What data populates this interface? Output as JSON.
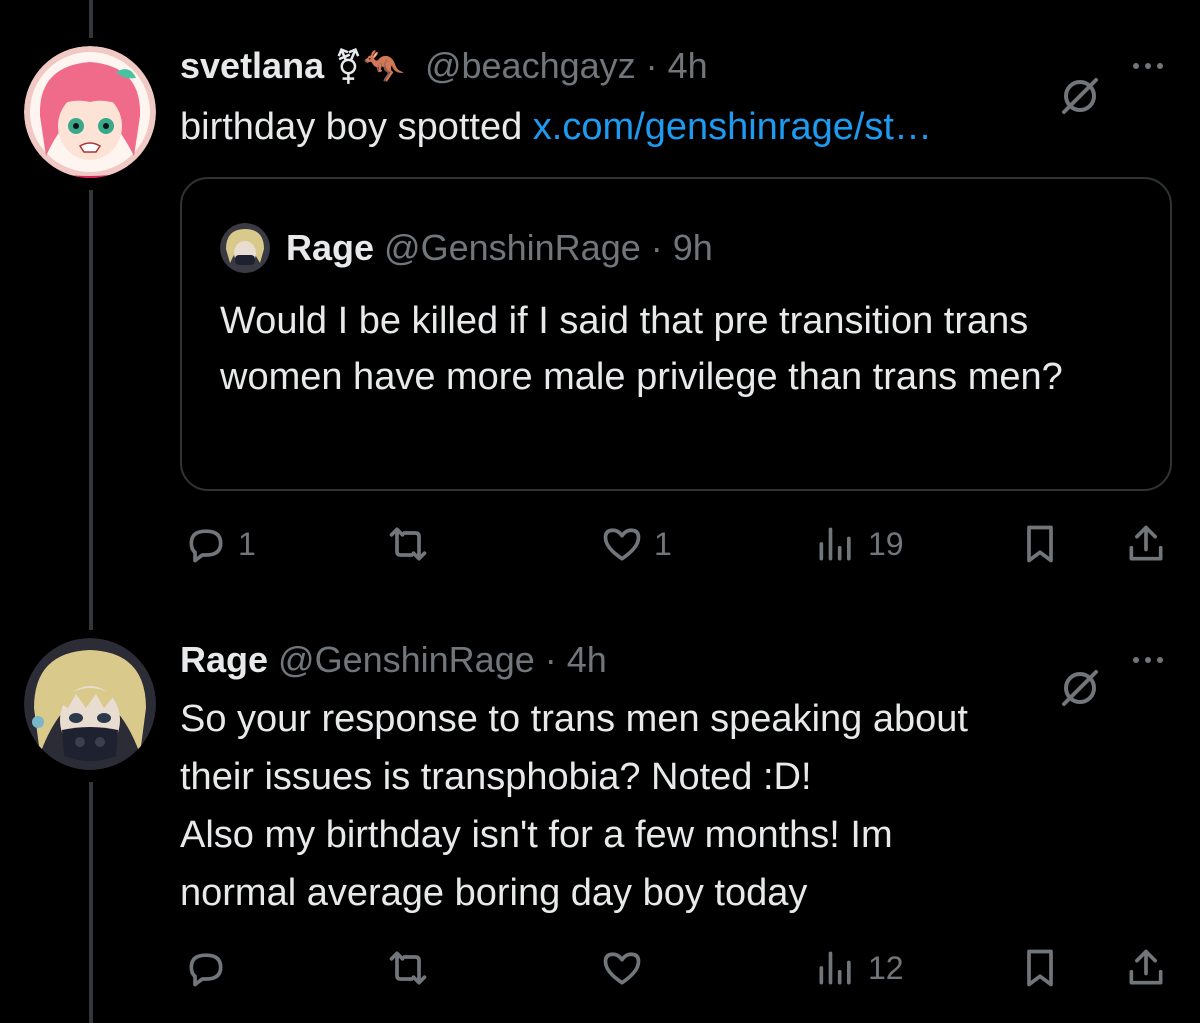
{
  "tweet1": {
    "name": "svetlana",
    "emojis": "⚧🦘",
    "handle": "@beachgayz",
    "time": "· 4h",
    "text": "birthday boy spotted",
    "link": "x.com/genshinrage/st…",
    "quote": {
      "name": "Rage",
      "handle": "@GenshinRage",
      "time": "· 9h",
      "text": "Would I be killed if I said that pre transition trans women have more male privilege than trans men?"
    },
    "actions": {
      "replies": "1",
      "retweets": "",
      "likes": "1",
      "views": "19"
    }
  },
  "tweet2": {
    "name": "Rage",
    "handle": "@GenshinRage",
    "time": "· 4h",
    "text_lines": [
      "So your response to trans men speaking about",
      "their issues is transphobia? Noted :D!",
      "Also my birthday isn't for a few months! Im",
      "normal average boring day boy today"
    ],
    "actions": {
      "replies": "",
      "retweets": "",
      "likes": "",
      "views": "12"
    }
  },
  "colors": {
    "background": "#000000",
    "text": "#e7e9ea",
    "muted": "#71767b",
    "link": "#1d9bf0",
    "border": "#2f3336"
  },
  "icons": [
    "reply-icon",
    "retweet-icon",
    "like-icon",
    "views-icon",
    "bookmark-icon",
    "share-icon",
    "grok-icon",
    "more-icon"
  ]
}
